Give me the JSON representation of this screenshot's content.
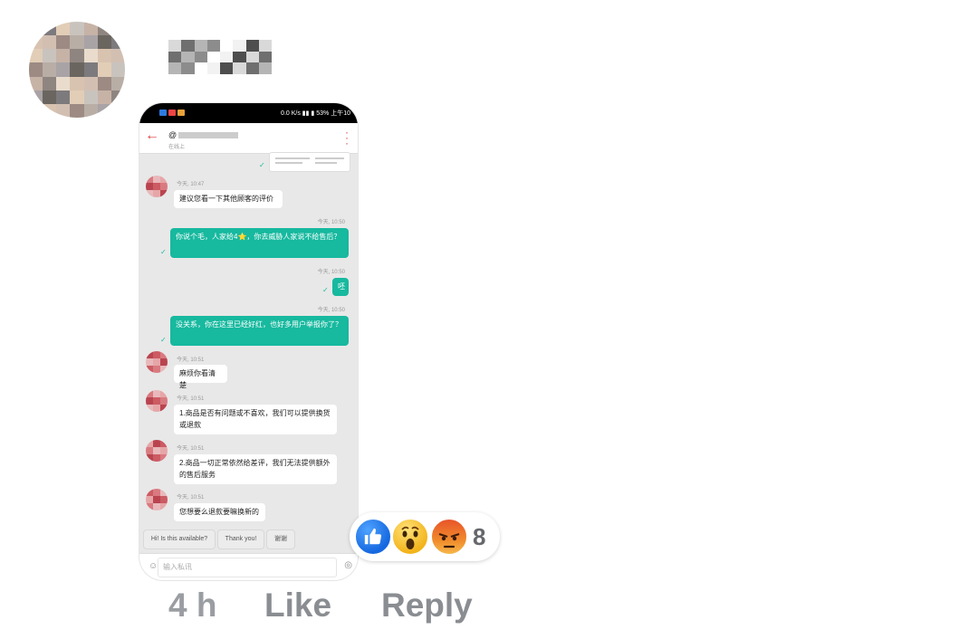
{
  "comment": {
    "author_avatar": "blurred-avatar",
    "author_name": "",
    "time": "4 h",
    "like_label": "Like",
    "reply_label": "Reply"
  },
  "reactions": {
    "icons": [
      "like-icon",
      "wow-icon",
      "angry-icon"
    ],
    "count": "8"
  },
  "screenshot": {
    "status": {
      "net_speed": "0.0 K/s",
      "battery": "53%",
      "clock": "上午10"
    },
    "chat": {
      "handle": "@",
      "presence": "在线上",
      "messages": [
        {
          "side": "in",
          "time": "今天, 10:47",
          "text": "建议您看一下其他顾客的评价"
        },
        {
          "side": "out",
          "time": "今天, 10:50",
          "text": "你说个毛，人家给4⭐，你去威胁人家说不给售后？"
        },
        {
          "side": "out",
          "time": "今天, 10:50",
          "text": "呸"
        },
        {
          "side": "out",
          "time": "今天, 10:50",
          "text": "没关系，你在这里已经好红，也好多用户举报你了？"
        },
        {
          "side": "in",
          "time": "今天, 10:51",
          "text": "麻烦你看清楚"
        },
        {
          "side": "in",
          "time": "今天, 10:51",
          "text": "1.商品是否有问题或不喜欢，我们可以提供换货或退款"
        },
        {
          "side": "in",
          "time": "今天, 10:51",
          "text": "2.商品一切正常依然给差评，我们无法提供额外的售后服务"
        },
        {
          "side": "in",
          "time": "今天, 10:51",
          "text": "您想要么退款要嘛换新的"
        }
      ],
      "quick_replies": [
        "Hi! Is this available?",
        "Thank you!",
        "谢谢"
      ],
      "input_placeholder": "输入私讯"
    }
  },
  "colors": {
    "accent_green": "#17b99f",
    "back_red": "#e04040",
    "meta_gray": "#8a8d91",
    "like_blue": "#1877f2"
  }
}
